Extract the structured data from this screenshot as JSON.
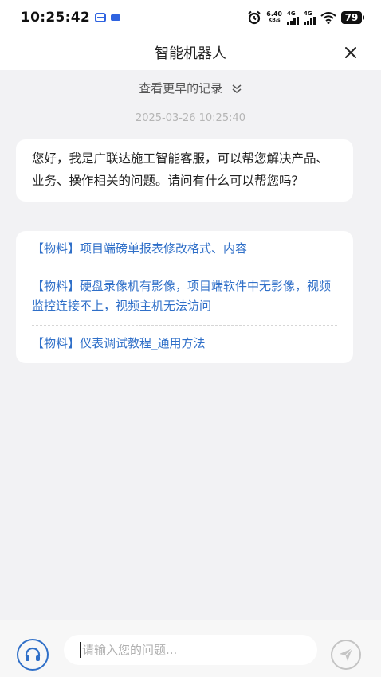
{
  "status_bar": {
    "time": "10:25:42",
    "net_speed_value": "6.40",
    "net_speed_unit": "KB/s",
    "signal1_label": "4G",
    "signal2_label": "4G",
    "battery": "79",
    "icons": [
      "app-notification-icon",
      "app-badge-icon",
      "alarm-icon",
      "signal-icon",
      "wifi-icon",
      "battery-icon"
    ]
  },
  "header": {
    "title": "智能机器人",
    "close_icon": "close-icon"
  },
  "chat": {
    "earlier_records_label": "查看更早的记录",
    "timestamp": "2025-03-26 10:25:40",
    "greeting": "您好，我是广联达施工智能客服，可以帮您解决产品、业务、操作相关的问题。请问有什么可以帮您吗？",
    "faq": [
      {
        "label": "【物料】项目端磅单报表修改格式、内容"
      },
      {
        "label": "【物料】硬盘录像机有影像，项目端软件中无影像，视频监控连接不上，视频主机无法访问"
      },
      {
        "label": "【物料】仪表调试教程_通用方法"
      }
    ]
  },
  "input_bar": {
    "placeholder": "请输入您的问题...",
    "value": "",
    "left_icon": "headset-icon",
    "right_icon": "send-icon"
  },
  "colors": {
    "link": "#2f6fc8",
    "background": "#f2f2f4",
    "accent_blue": "#2f63e0"
  }
}
